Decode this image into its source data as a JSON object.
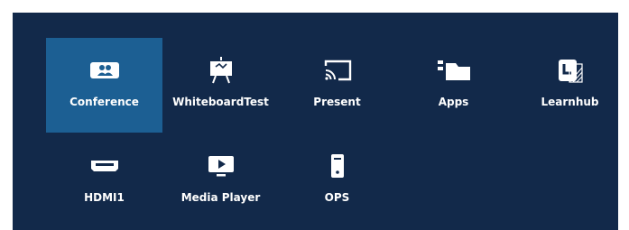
{
  "launcher": {
    "apps": [
      {
        "label": "Conference",
        "icon": "conference-icon",
        "selected": true
      },
      {
        "label": "WhiteboardTest",
        "icon": "whiteboard-icon",
        "selected": false
      },
      {
        "label": "Present",
        "icon": "cast-icon",
        "selected": false
      },
      {
        "label": "Apps",
        "icon": "apps-icon",
        "selected": false
      },
      {
        "label": "Learnhub",
        "icon": "learnhub-icon",
        "selected": false
      },
      {
        "label": "HDMI1",
        "icon": "hdmi-icon",
        "selected": false
      },
      {
        "label": "Media Player",
        "icon": "media-player-icon",
        "selected": false
      },
      {
        "label": "OPS",
        "icon": "ops-icon",
        "selected": false
      }
    ]
  },
  "colors": {
    "background": "#12294a",
    "selected_tile": "#1c5f93",
    "text": "#ffffff"
  }
}
